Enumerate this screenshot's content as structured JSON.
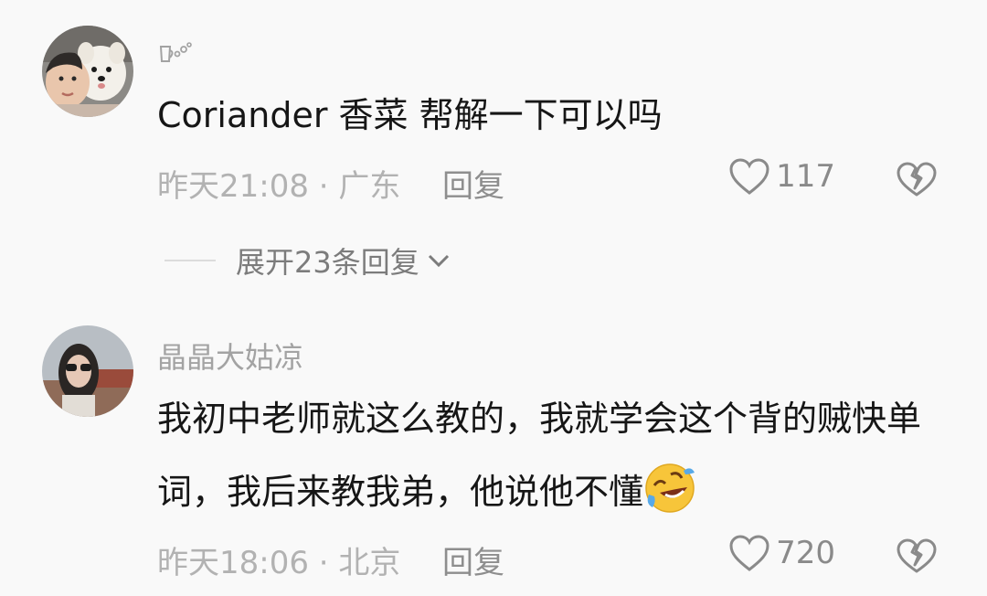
{
  "comments": [
    {
      "username": "",
      "text": "Coriander 香菜  帮解一下可以吗",
      "meta": "昨天21:08 · 广东",
      "reply_label": "回复",
      "likes": "117",
      "expand_label": "展开23条回复"
    },
    {
      "username": "晶晶大姑凉",
      "text": "我初中老师就这么教的，我就学会这个背的贼快单词，我后来教我弟，他说他不懂",
      "meta": "昨天18:06 · 北京",
      "reply_label": "回复",
      "likes": "720"
    }
  ],
  "icons": {
    "like": "heart-outline-icon",
    "dislike": "broken-heart-icon",
    "expand": "chevron-down-icon",
    "username_badge": "beer-mug-bubbles-icon",
    "emoji": "rolling-on-floor-laughing-emoji"
  },
  "colors": {
    "background": "#f9f9f9",
    "text": "#161616",
    "secondary": "#a3a3a3",
    "icon": "#8a8a8a"
  }
}
